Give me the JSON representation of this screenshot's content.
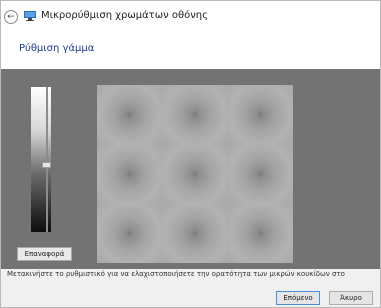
{
  "window": {
    "title": "Μικρορύθμιση χρωμάτων οθόνης",
    "back_glyph": "←"
  },
  "header": {
    "page_title": "Ρύθμιση γάμμα"
  },
  "controls": {
    "reset_label": "Επαναφορά",
    "slider_level": 0.54
  },
  "gamma_grid": {
    "rows": 3,
    "cols": 3
  },
  "instruction": "Μετακινήστε το ρυθμιστικό για να ελαχιστοποιήσετε την ορατότητα των μικρών κουκίδων στο",
  "footer": {
    "next_label": "Επόμενο",
    "cancel_label": "Άκυρο"
  },
  "colors": {
    "title_accent": "#1f3c91",
    "panel_bg": "#737373",
    "gamma_bg": "#a9a9a9"
  }
}
